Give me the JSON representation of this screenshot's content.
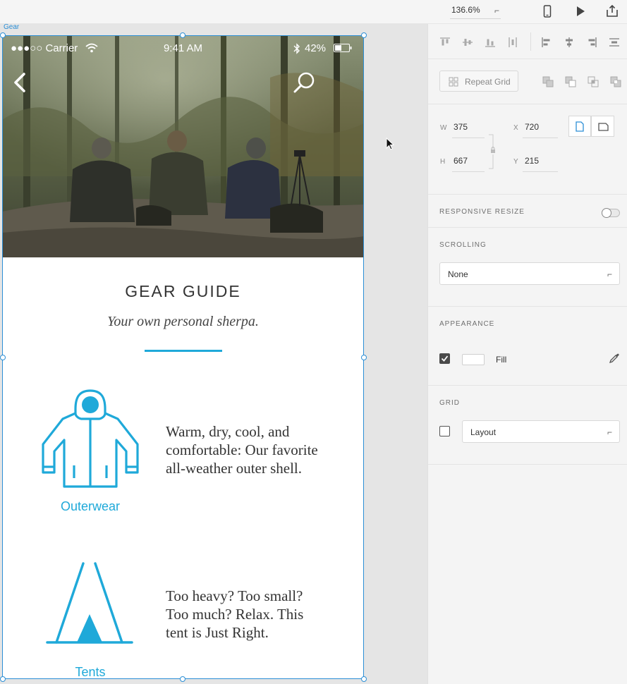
{
  "toolbar": {
    "zoom_value": "136.6%",
    "zoom_caret": "⌐"
  },
  "canvas": {
    "artboard_name": "Gear"
  },
  "app": {
    "status_bar": {
      "carrier": "●●●○○ Carrier",
      "time": "9:41 AM",
      "battery": "42%"
    },
    "title": "GEAR GUIDE",
    "subtitle": "Your own personal sherpa.",
    "categories": [
      {
        "label": "Outerwear",
        "description_lines": [
          "Warm, dry, cool, and",
          "comfortable: Our favorite",
          "all-weather outer shell."
        ]
      },
      {
        "label": "Tents",
        "description_lines": [
          "Too heavy? Too small?",
          "Too much? Relax. This",
          "tent is Just Right."
        ]
      }
    ],
    "accent_color": "#1fa9d9"
  },
  "inspector": {
    "repeat_grid_label": "Repeat Grid",
    "width_label": "W",
    "width_value": "375",
    "height_label": "H",
    "height_value": "667",
    "x_label": "X",
    "x_value": "720",
    "y_label": "Y",
    "y_value": "215",
    "responsive_resize_title": "RESPONSIVE RESIZE",
    "scrolling_title": "SCROLLING",
    "scrolling_value": "None",
    "appearance_title": "APPEARANCE",
    "fill_label": "Fill",
    "grid_title": "GRID",
    "grid_value": "Layout",
    "dropdown_caret": "⌐"
  }
}
